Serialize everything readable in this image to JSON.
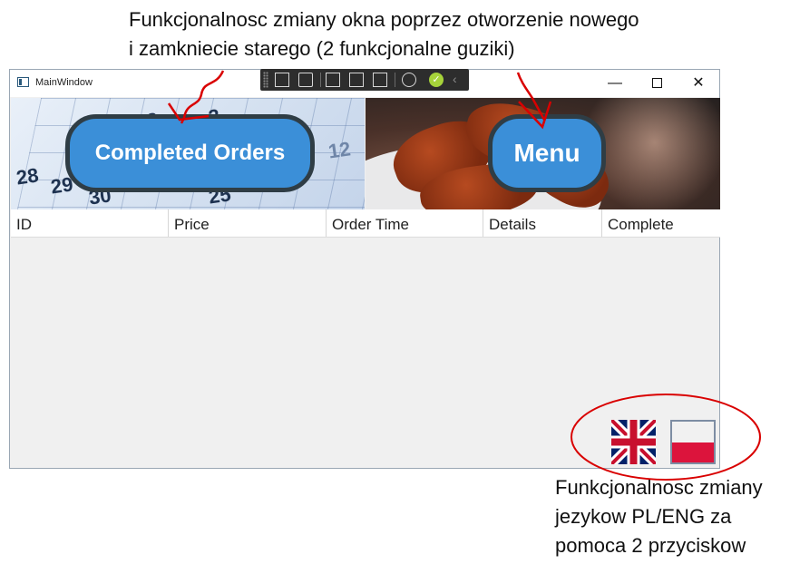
{
  "annotations": {
    "top_line1": "Funkcjonalnosc zmiany okna poprzez otworzenie nowego",
    "top_line2": "i zamkniecie starego (2 funkcjonalne guziki)",
    "bottom_line1": "Funkcjonalnosc zmiany",
    "bottom_line2": "jezykow PL/ENG za",
    "bottom_line3": "pomoca 2 przyciskow"
  },
  "window": {
    "title": "MainWindow",
    "minimize_glyph": "—",
    "close_glyph": "✕"
  },
  "debug_toolbar": {
    "ok_glyph": "✓",
    "collapse_glyph": "‹"
  },
  "buttons": {
    "completed_orders": "Completed Orders",
    "menu": "Menu"
  },
  "grid": {
    "columns": [
      "ID",
      "Price",
      "Order Time",
      "Details",
      "Complete"
    ]
  },
  "banner_left": {
    "numbers": [
      "2",
      "3",
      "12",
      "28",
      "29",
      "30",
      "25"
    ]
  },
  "languages": {
    "english_flag": "uk-flag-icon",
    "polish_flag": "pl-flag-icon"
  },
  "colors": {
    "button_blue": "#3b8fd8",
    "button_border": "#2f3d45",
    "annotation_red": "#d90000",
    "flag_red": "#dc143c"
  }
}
